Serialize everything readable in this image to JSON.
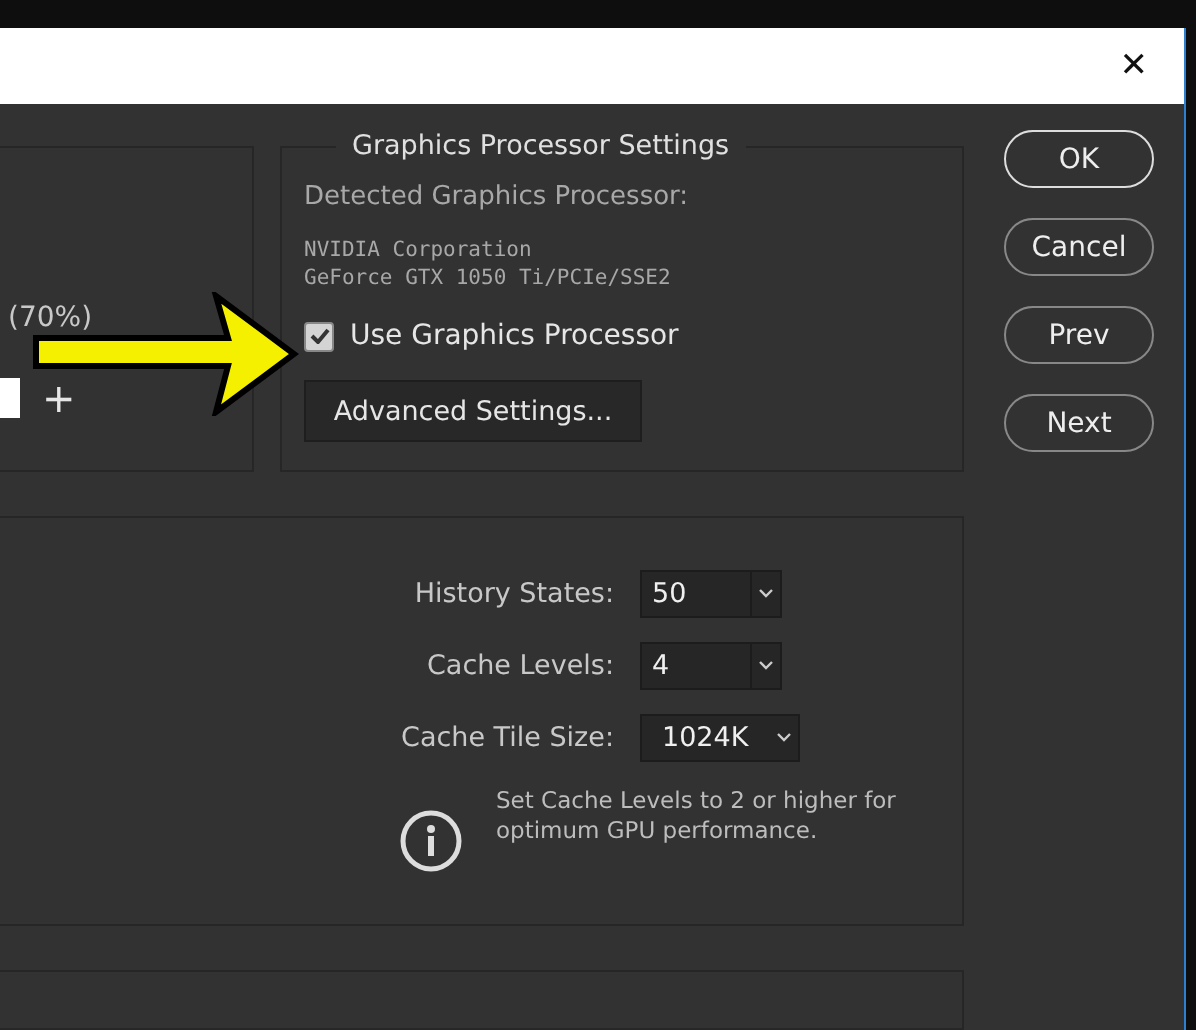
{
  "window": {
    "close": "✕"
  },
  "memory": {
    "percent": "(70%)",
    "plus": "+"
  },
  "gpu": {
    "title": "Graphics Processor Settings",
    "detected_label": "Detected Graphics Processor:",
    "vendor": "NVIDIA Corporation",
    "model": "GeForce GTX 1050 Ti/PCIe/SSE2",
    "use_gpu": {
      "label": "Use Graphics Processor",
      "checked": true
    },
    "advanced": "Advanced Settings..."
  },
  "buttons": [
    "OK",
    "Cancel",
    "Prev",
    "Next"
  ],
  "history": {
    "fields": [
      {
        "label": "History States:",
        "value": "50",
        "kind": "combo"
      },
      {
        "label": "Cache Levels:",
        "value": "4",
        "kind": "combo"
      },
      {
        "label": "Cache Tile Size:",
        "value": "1024K",
        "kind": "dropdown"
      }
    ],
    "note": "Set Cache Levels to 2 or higher for optimum GPU performance."
  }
}
